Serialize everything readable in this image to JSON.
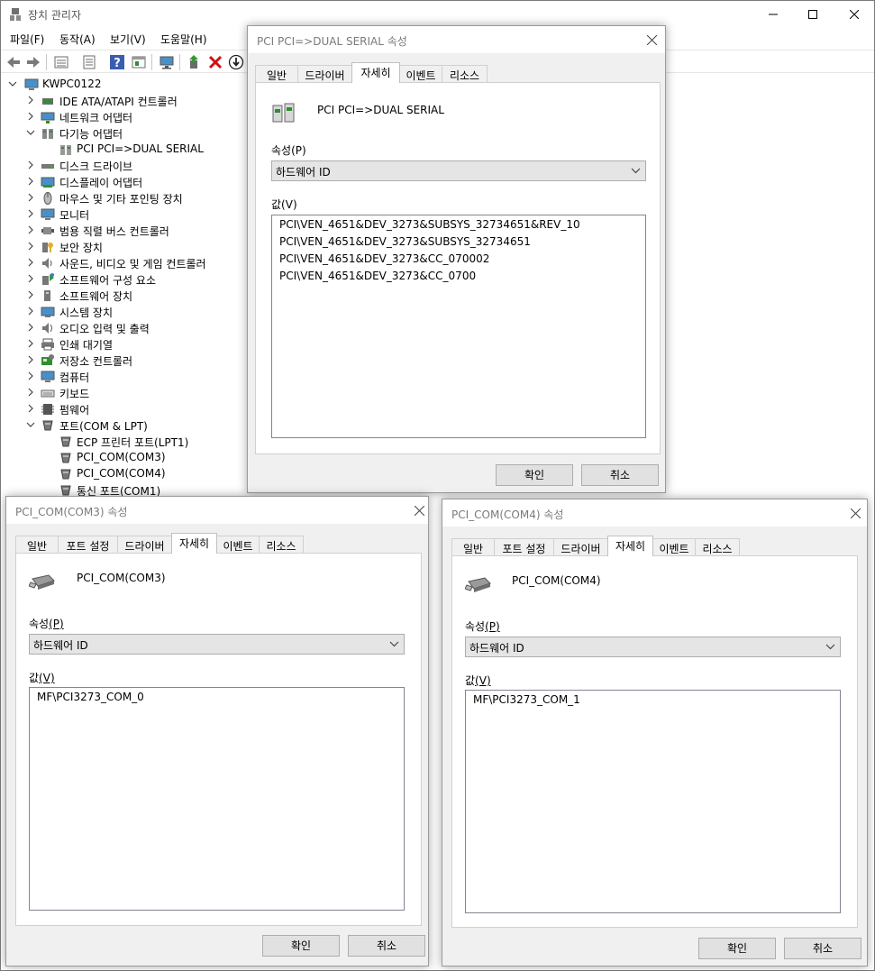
{
  "window": {
    "title": "장치 관리자",
    "menu": [
      "파일(F)",
      "동작(A)",
      "보기(V)",
      "도움말(H)"
    ]
  },
  "tree": {
    "root": "KWPC0122",
    "items": [
      {
        "label": "IDE ATA/ATAPI 컨트롤러",
        "icon": "ide-controller-icon",
        "expanded": false
      },
      {
        "label": "네트워크 어댑터",
        "icon": "network-adapter-icon",
        "expanded": false
      },
      {
        "label": "다기능 어댑터",
        "icon": "multifunction-adapter-icon",
        "expanded": true
      },
      {
        "label": "PCI PCI=>DUAL SERIAL",
        "icon": "pci-device-icon",
        "child": true
      },
      {
        "label": "디스크 드라이브",
        "icon": "disk-drive-icon",
        "expanded": false
      },
      {
        "label": "디스플레이 어댑터",
        "icon": "display-adapter-icon",
        "expanded": false
      },
      {
        "label": "마우스 및 기타 포인팅 장치",
        "icon": "mouse-icon",
        "expanded": false
      },
      {
        "label": "모니터",
        "icon": "monitor-icon",
        "expanded": false
      },
      {
        "label": "범용 직렬 버스 컨트롤러",
        "icon": "usb-controller-icon",
        "expanded": false
      },
      {
        "label": "보안 장치",
        "icon": "security-device-icon",
        "expanded": false
      },
      {
        "label": "사운드, 비디오 및 게임 컨트롤러",
        "icon": "sound-icon",
        "expanded": false
      },
      {
        "label": "소프트웨어 구성 요소",
        "icon": "software-component-icon",
        "expanded": false
      },
      {
        "label": "소프트웨어 장치",
        "icon": "software-device-icon",
        "expanded": false
      },
      {
        "label": "시스템 장치",
        "icon": "system-device-icon",
        "expanded": false
      },
      {
        "label": "오디오 입력 및 출력",
        "icon": "audio-io-icon",
        "expanded": false
      },
      {
        "label": "인쇄 대기열",
        "icon": "print-queue-icon",
        "expanded": false
      },
      {
        "label": "저장소 컨트롤러",
        "icon": "storage-controller-icon",
        "expanded": false
      },
      {
        "label": "컴퓨터",
        "icon": "computer-icon",
        "expanded": false
      },
      {
        "label": "키보드",
        "icon": "keyboard-icon",
        "expanded": false
      },
      {
        "label": "펌웨어",
        "icon": "firmware-icon",
        "expanded": false
      },
      {
        "label": "포트(COM & LPT)",
        "icon": "port-icon",
        "expanded": true
      },
      {
        "label": "ECP 프린터 포트(LPT1)",
        "icon": "port-device-icon",
        "child": true
      },
      {
        "label": "PCI_COM(COM3)",
        "icon": "port-device-icon",
        "child": true
      },
      {
        "label": "PCI_COM(COM4)",
        "icon": "port-device-icon",
        "child": true
      },
      {
        "label": "통신 포트(COM1)",
        "icon": "port-device-icon",
        "child": true
      }
    ]
  },
  "tab_labels": {
    "general": "일반",
    "port_settings": "포트 설정",
    "driver": "드라이버",
    "details": "자세히",
    "events": "이벤트",
    "resources": "리소스"
  },
  "property_label": "속성(P)",
  "property_label_main": "속성",
  "property_label_key": "(P)",
  "value_label_main": "값",
  "value_label_key": "(V)",
  "ok_label": "확인",
  "cancel_label": "취소",
  "dialog_dual": {
    "title": "PCI PCI=>DUAL SERIAL 속성",
    "device_name": "PCI PCI=>DUAL SERIAL",
    "property_value": "하드웨어 ID",
    "values": [
      "PCI\\VEN_4651&DEV_3273&SUBSYS_32734651&REV_10",
      "PCI\\VEN_4651&DEV_3273&SUBSYS_32734651",
      "PCI\\VEN_4651&DEV_3273&CC_070002",
      "PCI\\VEN_4651&DEV_3273&CC_0700"
    ]
  },
  "dialog_com3": {
    "title": "PCI_COM(COM3) 속성",
    "device_name": "PCI_COM(COM3)",
    "property_value": "하드웨어 ID",
    "values": [
      "MF\\PCI3273_COM_0"
    ]
  },
  "dialog_com4": {
    "title": "PCI_COM(COM4) 속성",
    "device_name": "PCI_COM(COM4)",
    "property_value": "하드웨어 ID",
    "values": [
      "MF\\PCI3273_COM_1"
    ]
  }
}
